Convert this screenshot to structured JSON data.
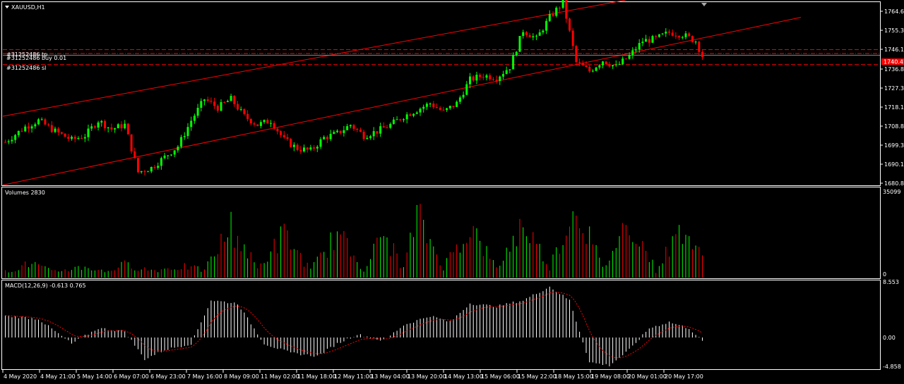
{
  "window": {
    "title": "XAUUSD,H1",
    "menu_icon": "triangle-down-icon",
    "scroll_marker": "triangle-down-icon"
  },
  "colors": {
    "background": "#000000",
    "frame": "#ffffff",
    "bull": "#00ff00",
    "bear": "#ff0000",
    "channel": "#ff0000",
    "order_line": "#ff0000",
    "current_price_tag": "#ff0000",
    "macd_hist": "#ffffff",
    "macd_signal": "#ff0000",
    "volume_up": "#00ff00",
    "volume_down": "#ff0000"
  },
  "main": {
    "order_labels": {
      "tp": "#31252486 tp",
      "buy": "#31252486 buy 0.01",
      "sl": "#31252486 sl"
    },
    "price_axis": [
      "1764.60",
      "1755.35",
      "1746.10",
      "1736.85",
      "1727.35",
      "1718.10",
      "1708.85",
      "1699.35",
      "1690.10",
      "1680.85"
    ],
    "current_price_tag": "1740.4",
    "order_prices": {
      "tp": 1743.0,
      "buy": 1741.2,
      "sl": 1736.0
    }
  },
  "volumes": {
    "title": "Volumes 2830",
    "axis_max": "35099",
    "axis_min": "0"
  },
  "macd": {
    "title": "MACD(12,26,9) -0.613 0.765",
    "axis": [
      "8.553",
      "0.00",
      "-4.858"
    ]
  },
  "time_axis": [
    "4 May 2020",
    "4 May 21:00",
    "5 May 14:00",
    "6 May 07:00",
    "6 May 23:00",
    "7 May 16:00",
    "8 May 09:00",
    "11 May 02:00",
    "11 May 18:00",
    "12 May 11:00",
    "13 May 04:00",
    "13 May 20:00",
    "14 May 13:00",
    "15 May 06:00",
    "15 May 22:00",
    "18 May 15:00",
    "19 May 08:00",
    "20 May 01:00",
    "20 May 17:00"
  ],
  "chart_data": {
    "type": "candlestick",
    "symbol": "XAUUSD",
    "timeframe": "H1",
    "y_range": [
      1680.85,
      1764.6
    ],
    "trend_channel": {
      "upper": [
        [
          0,
          1712
        ],
        [
          187,
          1766
        ]
      ],
      "lower": [
        [
          65,
          1680
        ],
        [
          240,
          1758
        ]
      ]
    },
    "close_anchor_points": [
      [
        0,
        1700
      ],
      [
        6,
        1707
      ],
      [
        10,
        1710
      ],
      [
        15,
        1705
      ],
      [
        20,
        1701
      ],
      [
        24,
        1703
      ],
      [
        28,
        1710
      ],
      [
        32,
        1706
      ],
      [
        36,
        1708
      ],
      [
        40,
        1686
      ],
      [
        44,
        1688
      ],
      [
        48,
        1693
      ],
      [
        52,
        1698
      ],
      [
        56,
        1710
      ],
      [
        60,
        1720
      ],
      [
        64,
        1716
      ],
      [
        68,
        1720
      ],
      [
        72,
        1712
      ],
      [
        76,
        1708
      ],
      [
        80,
        1710
      ],
      [
        84,
        1701
      ],
      [
        88,
        1697
      ],
      [
        92,
        1696
      ],
      [
        96,
        1702
      ],
      [
        100,
        1704
      ],
      [
        104,
        1708
      ],
      [
        108,
        1703
      ],
      [
        112,
        1705
      ],
      [
        116,
        1708
      ],
      [
        120,
        1712
      ],
      [
        124,
        1715
      ],
      [
        128,
        1718
      ],
      [
        132,
        1714
      ],
      [
        136,
        1718
      ],
      [
        140,
        1729
      ],
      [
        144,
        1731
      ],
      [
        148,
        1730
      ],
      [
        152,
        1735
      ],
      [
        156,
        1752
      ],
      [
        160,
        1748
      ],
      [
        164,
        1758
      ],
      [
        168,
        1765
      ],
      [
        172,
        1737
      ],
      [
        176,
        1733
      ],
      [
        180,
        1738
      ],
      [
        184,
        1735
      ],
      [
        188,
        1740
      ],
      [
        192,
        1747
      ],
      [
        196,
        1748
      ],
      [
        200,
        1751
      ],
      [
        204,
        1750
      ],
      [
        208,
        1747
      ],
      [
        210,
        1740
      ]
    ],
    "volume_anchor_points": [
      [
        0,
        0.08
      ],
      [
        8,
        0.2
      ],
      [
        14,
        0.08
      ],
      [
        24,
        0.15
      ],
      [
        30,
        0.08
      ],
      [
        36,
        0.18
      ],
      [
        44,
        0.1
      ],
      [
        54,
        0.15
      ],
      [
        60,
        0.1
      ],
      [
        68,
        0.7
      ],
      [
        76,
        0.12
      ],
      [
        84,
        0.6
      ],
      [
        92,
        0.1
      ],
      [
        100,
        0.6
      ],
      [
        108,
        0.12
      ],
      [
        114,
        0.6
      ],
      [
        120,
        0.12
      ],
      [
        124,
        0.85
      ],
      [
        132,
        0.15
      ],
      [
        140,
        0.7
      ],
      [
        148,
        0.12
      ],
      [
        156,
        0.75
      ],
      [
        164,
        0.15
      ],
      [
        172,
        1.0
      ],
      [
        180,
        0.12
      ],
      [
        188,
        0.8
      ],
      [
        196,
        0.1
      ],
      [
        204,
        0.7
      ],
      [
        210,
        0.25
      ]
    ],
    "macd_anchor_points": [
      [
        0,
        3.5
      ],
      [
        10,
        3
      ],
      [
        20,
        -1
      ],
      [
        28,
        1.5
      ],
      [
        36,
        1
      ],
      [
        42,
        -3.5
      ],
      [
        48,
        -2
      ],
      [
        56,
        -1
      ],
      [
        62,
        6
      ],
      [
        70,
        5.5
      ],
      [
        78,
        -1
      ],
      [
        86,
        -2.5
      ],
      [
        94,
        -3
      ],
      [
        100,
        -1
      ],
      [
        106,
        0.5
      ],
      [
        114,
        -0.5
      ],
      [
        120,
        2
      ],
      [
        128,
        3.5
      ],
      [
        134,
        2.5
      ],
      [
        140,
        5.5
      ],
      [
        148,
        5
      ],
      [
        156,
        6
      ],
      [
        164,
        8.2
      ],
      [
        170,
        6
      ],
      [
        176,
        -4
      ],
      [
        182,
        -4.5
      ],
      [
        188,
        -2
      ],
      [
        194,
        1.5
      ],
      [
        200,
        2.5
      ],
      [
        206,
        1.5
      ],
      [
        210,
        -0.6
      ]
    ]
  }
}
